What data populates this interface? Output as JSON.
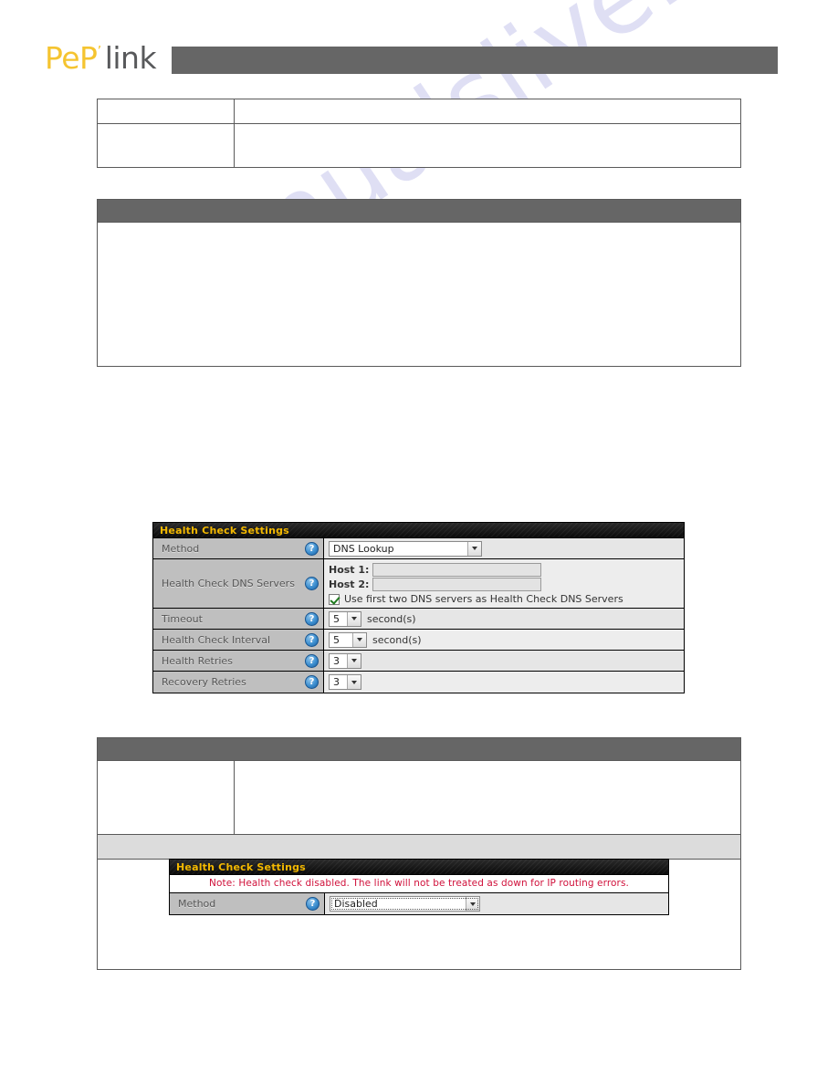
{
  "brand": {
    "logo_primary": "PeP",
    "logo_tm": "’",
    "logo_secondary": "link",
    "bar_color": "#666666"
  },
  "watermark": {
    "text": "manualslive.com",
    "color": "#ccccee"
  },
  "health_check_main": {
    "title": "Health Check Settings",
    "rows": [
      {
        "label": "Method",
        "help_icon": "question-mark-icon",
        "control": "select",
        "value": "DNS Lookup"
      },
      {
        "label": "Health Check DNS Servers",
        "help_icon": "question-mark-icon",
        "control": "hosts",
        "host1_label": "Host 1:",
        "host1_value": "",
        "host2_label": "Host 2:",
        "host2_value": "",
        "checkbox_label": "Use first two DNS servers as Health Check DNS Servers",
        "checkbox_checked": true
      },
      {
        "label": "Timeout",
        "help_icon": "question-mark-icon",
        "control": "select",
        "value": "5",
        "unit": "second(s)"
      },
      {
        "label": "Health Check Interval",
        "help_icon": "question-mark-icon",
        "control": "select",
        "value": "5",
        "unit": "second(s)"
      },
      {
        "label": "Health Retries",
        "help_icon": "question-mark-icon",
        "control": "select",
        "value": "3",
        "unit": ""
      },
      {
        "label": "Recovery Retries",
        "help_icon": "question-mark-icon",
        "control": "select",
        "value": "3",
        "unit": ""
      }
    ]
  },
  "health_check_disabled": {
    "title": "Health Check Settings",
    "note": "Note: Health check disabled. The link will not be treated as down for IP routing errors.",
    "note_color": "#d0103a",
    "rows": [
      {
        "label": "Method",
        "help_icon": "question-mark-icon",
        "control": "select",
        "value": "Disabled"
      }
    ]
  },
  "doc_tables": {
    "top": {
      "cell_r1_left": "",
      "cell_r1_right": "",
      "cell_r2_left": "",
      "cell_r2_right": ""
    },
    "panel2": {
      "header": "",
      "body": ""
    },
    "bottom": {
      "header": "",
      "cell_left": "",
      "cell_right": "",
      "band": ""
    }
  }
}
